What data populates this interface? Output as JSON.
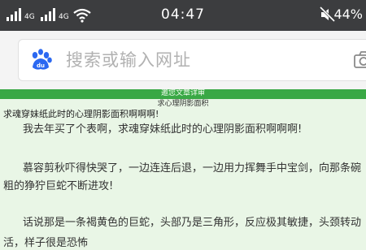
{
  "status_bar": {
    "signal1_tag": "4G",
    "signal2_tag": "4G",
    "time": "04:47",
    "battery": "44",
    "icons": [
      "signal-icon",
      "wifi-icon",
      "mute-icon",
      "battery-icon"
    ]
  },
  "browser": {
    "search_placeholder": "搜索或输入网址",
    "logo": "baidu-paw-icon",
    "camera": "camera-icon",
    "logo_color": "#2b68f1"
  },
  "page": {
    "header_color": "#39a845",
    "background": "#e9f6e6",
    "title": "邀您文章详审",
    "subtitle": "求心理阴影面积",
    "heading": "求魂穿妹纸此时的心理阴影面积啊啊啊!",
    "paragraphs": [
      "我去年买了个表啊，求魂穿妹纸此时的心理阴影面积啊啊啊!",
      "慕容剪秋吓得快哭了，一边连连后退，一边用力挥舞手中宝剑，向那条碗",
      "粗的狰狞巨蛇不断进攻!",
      "话说那是一条褐黄色的巨蛇，头部乃是三角形，反应极其敏捷，头颈转动",
      "活，样子很是恐怖"
    ]
  }
}
